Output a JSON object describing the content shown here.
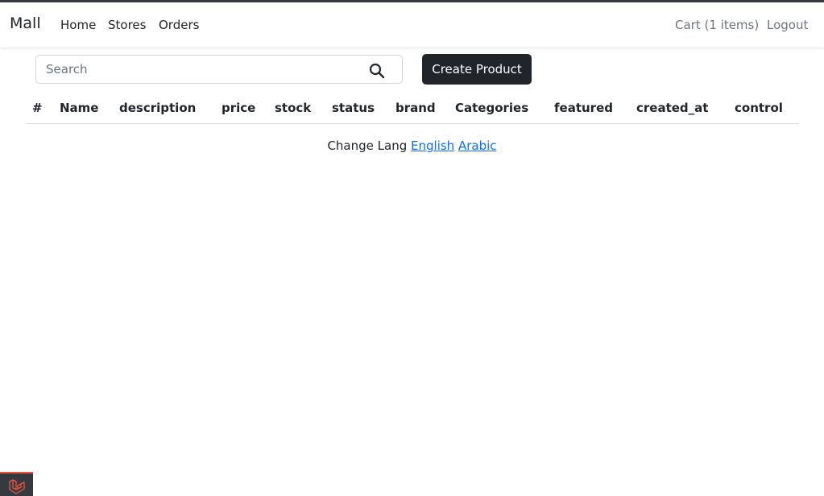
{
  "navbar": {
    "brand": "Mall",
    "links": [
      "Home",
      "Stores",
      "Orders"
    ],
    "cart": "Cart (1 items)",
    "logout": "Logout"
  },
  "search": {
    "placeholder": "Search",
    "value": ""
  },
  "actions": {
    "create_label": "Create Product"
  },
  "table": {
    "columns": [
      "#",
      "Name",
      "description",
      "price",
      "stock",
      "status",
      "brand",
      "Categories",
      "featured",
      "created_at",
      "control"
    ],
    "rows": []
  },
  "footer": {
    "change_lang": "Change Lang",
    "english": "English",
    "arabic": "Arabic"
  },
  "colors": {
    "link": "#0d6efd",
    "dark": "#212529",
    "laravel": "#f05340"
  },
  "icons": {
    "search": "search-icon",
    "laravel": "laravel-logo-icon"
  }
}
